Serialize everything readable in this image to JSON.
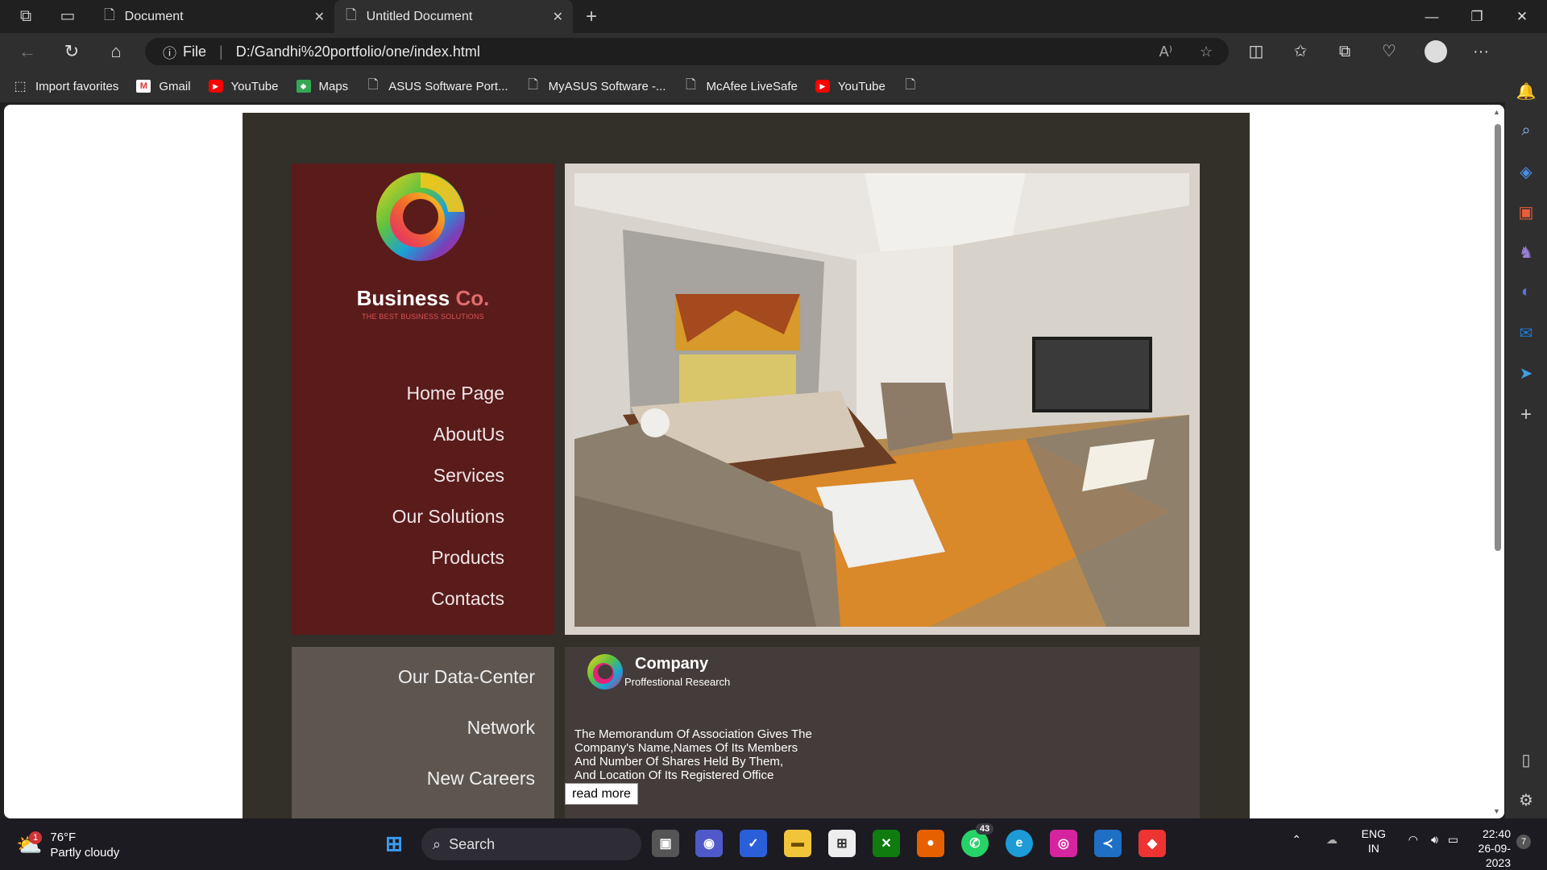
{
  "browser": {
    "tabs": [
      {
        "title": "Document",
        "active": false
      },
      {
        "title": "Untitled Document",
        "active": true
      }
    ],
    "url_scheme": "File",
    "url": "D:/Gandhi%20portfolio/one/index.html",
    "favorites": [
      {
        "label": "Import favorites",
        "icon": "import-icon"
      },
      {
        "label": "Gmail",
        "icon": "gmail-icon"
      },
      {
        "label": "YouTube",
        "icon": "youtube-icon"
      },
      {
        "label": "Maps",
        "icon": "maps-icon"
      },
      {
        "label": "ASUS Software Port...",
        "icon": "doc-icon"
      },
      {
        "label": "MyASUS Software -...",
        "icon": "doc-icon"
      },
      {
        "label": "McAfee LiveSafe",
        "icon": "doc-icon"
      },
      {
        "label": "YouTube",
        "icon": "youtube-icon"
      }
    ]
  },
  "site": {
    "brand_name": "Business",
    "brand_suffix": "Co.",
    "tagline": "THE BEST BUSINESS SOLUTIONS",
    "menu": [
      "Home Page",
      "AboutUs",
      "Services",
      "Our Solutions",
      "Products",
      "Contacts"
    ],
    "menu2": [
      "Our Data-Center",
      "Network",
      "New Careers"
    ],
    "company": {
      "title": "Company",
      "subtitle": "Proffestional Research",
      "body": [
        "The Memorandum Of Association Gives The",
        "Company's Name,Names Of Its Members",
        "And Number Of Shares Held By Them,",
        "And Location Of Its Registered Office"
      ],
      "button": "read more"
    },
    "colors": {
      "accent": "#5a1b1b",
      "brand_highlight": "#e06b6b"
    }
  },
  "taskbar": {
    "weather_temp": "76°F",
    "weather_desc": "Partly cloudy",
    "weather_badge": "1",
    "search_label": "Search",
    "whatsapp_badge": "43",
    "lang": "ENG",
    "region": "IN",
    "time": "22:40",
    "date": "26-09-2023",
    "notif_count": "7"
  }
}
